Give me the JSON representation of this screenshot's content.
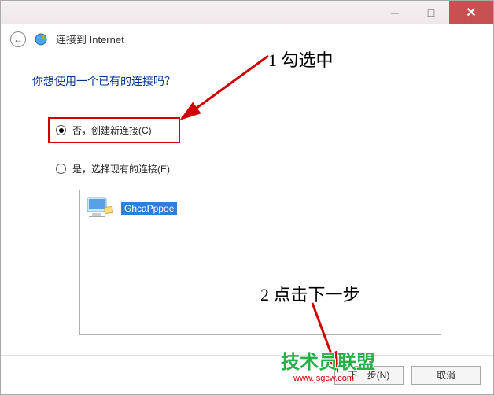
{
  "titlebar": {
    "minimize": "─",
    "maximize": "□",
    "close": "✕"
  },
  "header": {
    "back_glyph": "←",
    "title": "连接到 Internet"
  },
  "content": {
    "question": "你想使用一个已有的连接吗？",
    "option_no": "否，创建新连接(C)",
    "option_yes": "是，选择现有的连接(E)"
  },
  "list": {
    "item_label": "GhcaPppoe"
  },
  "footer": {
    "next": "下一步(N)",
    "cancel": "取消"
  },
  "annotations": {
    "a1": "1 勾选中",
    "a2": "2 点击下一步"
  },
  "watermark": {
    "logo_text": "技术员联盟",
    "url": "www.jsgcw.com"
  }
}
